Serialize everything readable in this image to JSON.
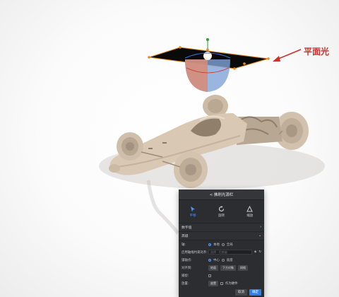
{
  "annotation": {
    "label": "平面光",
    "color": "#d0302a"
  },
  "panel": {
    "title": "< 拂刷光源栏",
    "tabs": [
      {
        "label": "平移",
        "icon": "move-icon",
        "active": true
      },
      {
        "label": "旋转",
        "icon": "rotate-icon",
        "active": false
      },
      {
        "label": "缩放",
        "icon": "scale-icon",
        "active": false
      }
    ],
    "section_numeric": "数字值",
    "section_advanced": "高级",
    "axis": {
      "label": "轴:",
      "options": [
        "本地",
        "全局"
      ],
      "selected": "本地"
    },
    "constraint": {
      "label": "启用轴线约束对齐:",
      "placeholder": "选择 · 约束轴"
    },
    "pivot": {
      "label": "锁轴点:",
      "options": [
        "中心",
        "底座"
      ],
      "selected": "中心"
    },
    "align": {
      "label": "对齐到:",
      "buttons": [
        "地面",
        "下方对象",
        "网格"
      ]
    },
    "snap": {
      "label": "捕捉:"
    },
    "place": {
      "label": "放置:",
      "button": "放置",
      "checkbox_label": "作为硬件"
    },
    "cancel_label": "取消",
    "ok_label": "确定",
    "accent_color": "#4b9bff"
  }
}
